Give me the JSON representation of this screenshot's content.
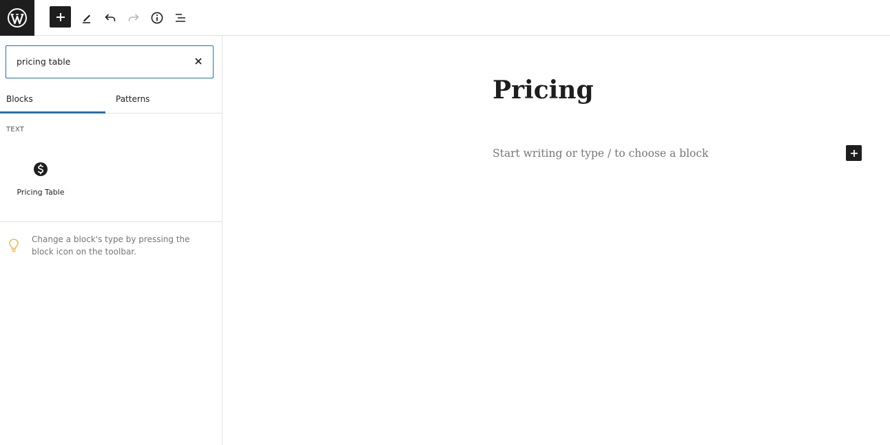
{
  "toolbar": {
    "logo_icon": "wordpress-logo-icon",
    "add_icon": "plus-icon",
    "tools_icon": "pencil-icon",
    "undo_icon": "undo-icon",
    "redo_icon": "redo-icon",
    "info_icon": "info-icon",
    "list_view_icon": "list-view-icon"
  },
  "inserter": {
    "search": {
      "value": "pricing table",
      "clear_icon": "close-icon"
    },
    "tabs": [
      {
        "label": "Blocks",
        "active": true
      },
      {
        "label": "Patterns",
        "active": false
      }
    ],
    "category": "TEXT",
    "results": [
      {
        "label": "Pricing Table",
        "icon": "dollar-circle-icon"
      }
    ],
    "tip": {
      "icon": "lightbulb-icon",
      "text": "Change a block's type by pressing the block icon on the toolbar."
    }
  },
  "editor": {
    "title": "Pricing",
    "placeholder": "Start writing or type / to choose a block",
    "add_block_icon": "plus-icon"
  },
  "colors": {
    "accent": "#2271b1",
    "dark": "#1e1e1e",
    "muted": "#757575",
    "tip_icon": "#f0b849"
  }
}
